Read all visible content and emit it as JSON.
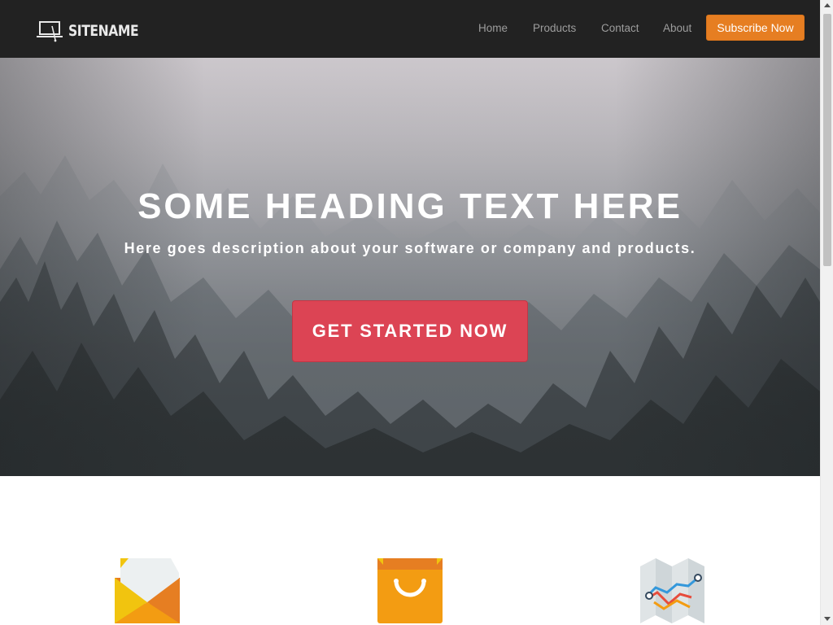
{
  "navbar": {
    "brand_name": "SITENAME",
    "brand_icon": "laptop-icon",
    "links": [
      "Home",
      "Products",
      "Contact",
      "About"
    ],
    "subscribe_label": "Subscribe Now",
    "background": "#222222",
    "accent": "#e67e22"
  },
  "hero": {
    "title": "SOME HEADING TEXT HERE",
    "description": "Here goes description about your software or company and products.",
    "cta_label": "GET STARTED NOW",
    "cta_color": "#dc4454",
    "background_image": "foggy-forest"
  },
  "features": {
    "icons": [
      "envelope-icon",
      "shopping-bag-icon",
      "map-icon"
    ]
  }
}
